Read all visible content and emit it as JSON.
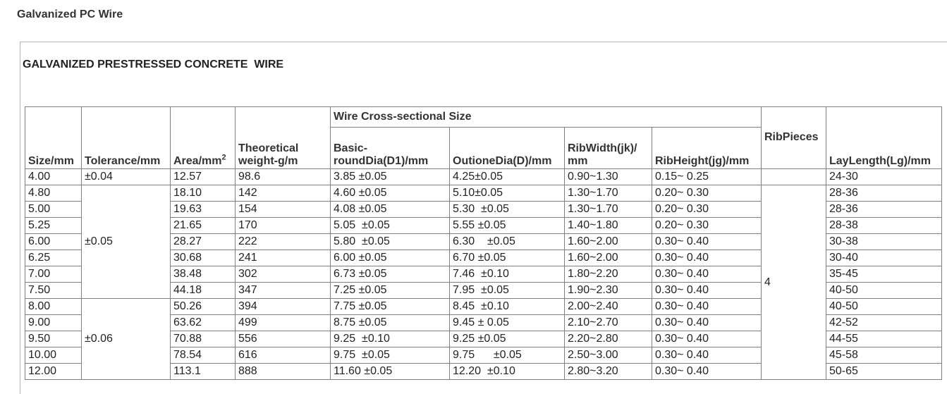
{
  "page_title": "Galvanized PC Wire",
  "panel_title": "GALVANIZED PRESTRESSED CONCRETE  WIRE",
  "table": {
    "headers": {
      "size": "Size/mm",
      "tolerance": "Tolerance/mm",
      "area": "Area/mm",
      "area_sup": "2",
      "weight": "Theoretical weight-g/m",
      "cross_section": "Wire Cross-sectional Size",
      "basic_dia": "Basic-roundDia(D1)/mm",
      "outer_dia": "OutioneDia(D)/mm",
      "rib_width": "RibWidth(jk)/ mm",
      "rib_height": "RibHeight(jg)/mm",
      "rib_pieces": "RibPieces",
      "lay_length": "LayLength(Lg)/mm"
    },
    "tolerance_groups": [
      "±0.04",
      "±0.05",
      "±0.06"
    ],
    "rib_pieces_value": "4",
    "rows": [
      {
        "size": "4.00",
        "area": "12.57",
        "weight": "98.6",
        "basic_dia": "3.85 ±0.05",
        "outer_dia": "4.25±0.05",
        "rib_width": "0.90~1.30",
        "rib_height": "0.15~ 0.25",
        "lay_length": "24-30"
      },
      {
        "size": "4.80",
        "area": "18.10",
        "weight": "142",
        "basic_dia": "4.60 ±0.05",
        "outer_dia": "5.10±0.05",
        "rib_width": "1.30~1.70",
        "rib_height": "0.20~ 0.30",
        "lay_length": "28-36"
      },
      {
        "size": "5.00",
        "area": "19.63",
        "weight": "154",
        "basic_dia": "4.08 ±0.05",
        "outer_dia": "5.30  ±0.05",
        "rib_width": "1.30~1.70",
        "rib_height": "0.20~ 0.30",
        "lay_length": "28-36"
      },
      {
        "size": "5.25",
        "area": "21.65",
        "weight": "170",
        "basic_dia": "5.05  ±0.05",
        "outer_dia": "5.55 ±0.05",
        "rib_width": "1.40~1.80",
        "rib_height": "0.20~ 0.30",
        "lay_length": "28-38"
      },
      {
        "size": "6.00",
        "area": "28.27",
        "weight": "222",
        "basic_dia": "5.80  ±0.05",
        "outer_dia": "6.30    ±0.05",
        "rib_width": "1.60~2.00",
        "rib_height": "0.30~ 0.40",
        "lay_length": "30-38"
      },
      {
        "size": "6.25",
        "area": "30.68",
        "weight": "241",
        "basic_dia": "6.00 ±0.05",
        "outer_dia": "6.70 ±0.05",
        "rib_width": "1.60~2.00",
        "rib_height": "0.30~ 0.40",
        "lay_length": "30-40"
      },
      {
        "size": "7.00",
        "area": "38.48",
        "weight": "302",
        "basic_dia": "6.73 ±0.05",
        "outer_dia": "7.46  ±0.10",
        "rib_width": "1.80~2.20",
        "rib_height": "0.30~ 0.40",
        "lay_length": "35-45"
      },
      {
        "size": "7.50",
        "area": "44.18",
        "weight": "347",
        "basic_dia": "7.25 ±0.05",
        "outer_dia": "7.95  ±0.05",
        "rib_width": "1.90~2.30",
        "rib_height": "0.30~ 0.40",
        "lay_length": "40-50"
      },
      {
        "size": "8.00",
        "area": "50.26",
        "weight": "394",
        "basic_dia": "7.75 ±0.05",
        "outer_dia": "8.45  ±0.10",
        "rib_width": "2.00~2.40",
        "rib_height": "0.30~ 0.40",
        "lay_length": "40-50"
      },
      {
        "size": "9.00",
        "area": "63.62",
        "weight": "499",
        "basic_dia": "8.75 ±0.05",
        "outer_dia": "9.45 ± 0.05",
        "rib_width": "2.10~2.70",
        "rib_height": "0.30~ 0.40",
        "lay_length": "42-52"
      },
      {
        "size": "9.50",
        "area": "70.88",
        "weight": "556",
        "basic_dia": "9.25  ±0.10",
        "outer_dia": "9.25 ±0.05",
        "rib_width": "2.20~2.80",
        "rib_height": "0.30~ 0.40",
        "lay_length": "44-55"
      },
      {
        "size": "10.00",
        "area": "78.54",
        "weight": "616",
        "basic_dia": "9.75  ±0.05",
        "outer_dia": "9.75      ±0.05",
        "rib_width": "2.50~3.00",
        "rib_height": "0.30~ 0.40",
        "lay_length": "45-58"
      },
      {
        "size": "12.00",
        "area": "113.1",
        "weight": "888",
        "basic_dia": "11.60 ±0.05",
        "outer_dia": "12.20  ±0.10",
        "rib_width": "2.80~3.20",
        "rib_height": "0.30~ 0.40",
        "lay_length": "50-65"
      }
    ]
  }
}
